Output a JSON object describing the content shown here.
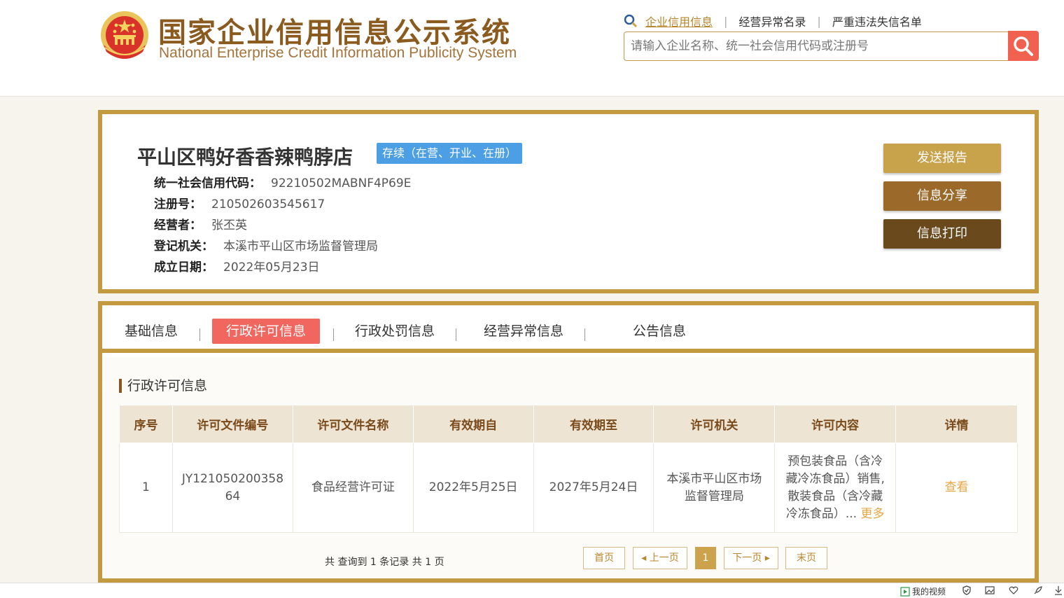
{
  "header": {
    "title_cn": "国家企业信用信息公示系统",
    "title_en": "National Enterprise Credit Information Publicity System",
    "nav": [
      "企业信用信息",
      "经营异常名录",
      "严重违法失信名单"
    ],
    "search_placeholder": "请输入企业名称、统一社会信用代码或注册号"
  },
  "company": {
    "name": "平山区鸭好香香辣鸭脖店",
    "status": "存续（在营、开业、在册）",
    "fields": [
      {
        "label": "统一社会信用代码：",
        "value": "92210502MABNF4P69E"
      },
      {
        "label": "注册号：",
        "value": "210502603545617"
      },
      {
        "label": "经营者：",
        "value": "张丕英"
      },
      {
        "label": "登记机关：",
        "value": "本溪市平山区市场监督管理局"
      },
      {
        "label": "成立日期：",
        "value": "2022年05月23日"
      }
    ],
    "actions": [
      "发送报告",
      "信息分享",
      "信息打印"
    ]
  },
  "tabs": [
    "基础信息",
    "行政许可信息",
    "行政处罚信息",
    "经营异常信息",
    "公告信息"
  ],
  "section_title": "行政许可信息",
  "table": {
    "headers": [
      "序号",
      "许可文件编号",
      "许可文件名称",
      "有效期自",
      "有效期至",
      "许可机关",
      "许可内容",
      "详情"
    ],
    "rows": [
      {
        "index": "1",
        "file_no_line1": "JY121050200358",
        "file_no_line2": "64",
        "file_name": "食品经营许可证",
        "valid_from": "2022年5月25日",
        "valid_to": "2027年5月24日",
        "authority_line1": "本溪市平山区市场",
        "authority_line2": "监督管理局",
        "content_lines": [
          "预包装食品（含冷",
          "藏冷冻食品）销售,",
          "散装食品（含冷藏",
          "冷冻食品）..."
        ],
        "content_more": "更多",
        "detail": "查看"
      }
    ]
  },
  "pagination": {
    "summary_prefix": "共 查询到",
    "records": "1",
    "summary_mid": "条记录 共",
    "pages": "1",
    "summary_suffix": "页",
    "first": "首页",
    "prev": "上一页",
    "current": "1",
    "next": "下一页",
    "last": "末页"
  },
  "statusbar": {
    "video": "我的视频"
  },
  "colors": {
    "gold_border": "#c49a40",
    "btn_report": "#c9a24c",
    "btn_share": "#9b6a2a",
    "btn_print": "#6a4a1c",
    "active_tab": "#f1665f",
    "status_badge": "#4c9ee5",
    "search_button": "#f1614f"
  }
}
